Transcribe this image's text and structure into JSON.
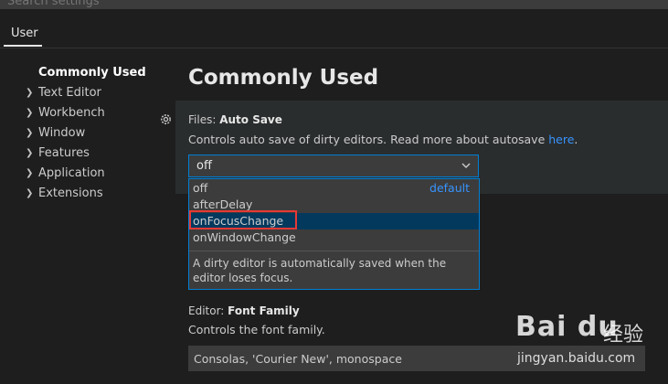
{
  "search": {
    "placeholder": "Search settings"
  },
  "tabs": [
    {
      "label": "User"
    }
  ],
  "toc": {
    "items": [
      {
        "label": "Commonly Used",
        "expandable": false,
        "active": true
      },
      {
        "label": "Text Editor",
        "expandable": true
      },
      {
        "label": "Workbench",
        "expandable": true
      },
      {
        "label": "Window",
        "expandable": true
      },
      {
        "label": "Features",
        "expandable": true
      },
      {
        "label": "Application",
        "expandable": true
      },
      {
        "label": "Extensions",
        "expandable": true
      }
    ]
  },
  "main": {
    "heading": "Commonly Used",
    "auto_save": {
      "category": "Files: ",
      "name": "Auto Save",
      "description": "Controls auto save of dirty editors. Read more about autosave ",
      "link_text": "here",
      "description_end": ".",
      "selected_value": "off",
      "options": [
        {
          "label": "off",
          "badge": "default"
        },
        {
          "label": "afterDelay"
        },
        {
          "label": "onFocusChange",
          "selected": true
        },
        {
          "label": "onWindowChange"
        }
      ],
      "option_description": "A dirty editor is automatically saved when the editor loses focus."
    },
    "font_family": {
      "category": "Editor: ",
      "name": "Font Family",
      "description": "Controls the font family.",
      "value": "Consolas, 'Courier New', monospace"
    }
  },
  "watermark": {
    "logo": "Bai du",
    "cn": "经验",
    "url": "jingyan.baidu.com"
  },
  "colors": {
    "accent": "#007fd4",
    "link": "#3794ff",
    "selection": "#04395e",
    "highlight": "#e53935"
  }
}
